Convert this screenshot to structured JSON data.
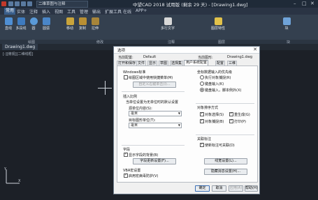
{
  "app": {
    "title": "中望CAD 2018 试用版 (剩余 29 天) - [Drawing1.dwg]",
    "workspace": "二维草图与注释"
  },
  "ribbon_tabs": [
    "常用",
    "实体",
    "注释",
    "插入",
    "视图",
    "工具",
    "管理",
    "输出",
    "扩展工具",
    "在线",
    "APP+"
  ],
  "ribbon": {
    "buttons": [
      "直线",
      "多段线",
      "圆",
      "圆弧",
      "移动",
      "复制",
      "拉伸",
      "多行文字",
      "图层特性",
      "块"
    ],
    "panels": [
      "绘图",
      "修改",
      "注释",
      "图层",
      "块"
    ]
  },
  "doc_tab": "Drawing1.dwg",
  "viewport_label": "[-][俯视][二维线框]",
  "dialog": {
    "title": "选项",
    "header": {
      "profile_label": "当前配置:",
      "profile_value": "Default",
      "drawing_label": "当前图形:",
      "drawing_value": "Drawing1.dwg"
    },
    "tabs": [
      "打开和保存",
      "文件",
      "显示",
      "草图",
      "选择集",
      "用户系统配置",
      "配置",
      "三维"
    ],
    "windows_std": {
      "title": "Windows标准",
      "shortcut_menu": "绘图区域中使用快捷菜单(M)",
      "right_click_btn": "自定义右键单击(I)..."
    },
    "insert_scale": {
      "title": "插入比例",
      "desc": "当单位设置为无单位时的默认设置",
      "source_label": "源单位内容(S):",
      "source_value": "毫米",
      "target_label": "目标图形单位(T):",
      "target_value": "毫米"
    },
    "fields": {
      "title": "字段",
      "display_bg": "显示字段的背景(B)",
      "update_btn": "字段更新设置(F)..."
    },
    "vba": {
      "title": "VBA宏设置",
      "enable": "启用宏病毒防护(V)"
    },
    "coord_priority": {
      "title": "坐标数据输入的优先级",
      "opt1": "执行对象捕捉(R)",
      "opt2": "键盘输入(K)",
      "opt3": "键盘输入，脚本例外(X)"
    },
    "obj_sort": {
      "title": "对象排序方式",
      "opt1": "对象选择(S)",
      "opt2": "重生成(G)",
      "opt3": "对象捕捉(B)",
      "opt4": "打印(P)"
    },
    "assoc_dim": {
      "title": "关联标注",
      "opt": "使新标注可关联(D)"
    },
    "lineweight_btn": "线宽设置(L)...",
    "hatch_btn": "隐藏消息设置(H)...",
    "buttons": {
      "ok": "确定",
      "cancel": "取消",
      "apply": "应用(A)",
      "help": "帮助(H)"
    }
  }
}
